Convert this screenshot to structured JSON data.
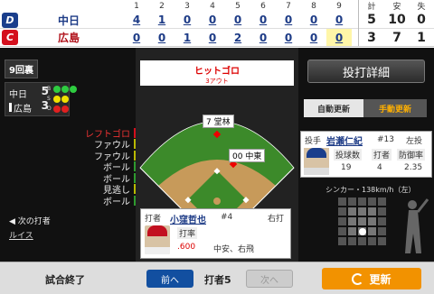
{
  "scoreboard": {
    "innings": [
      "1",
      "2",
      "3",
      "4",
      "5",
      "6",
      "7",
      "8",
      "9"
    ],
    "total_headers": [
      "計",
      "安",
      "失"
    ],
    "teams": [
      {
        "name": "中日",
        "logo": "D",
        "logo_icon": "dragons-logo-icon",
        "runs": [
          "4",
          "1",
          "0",
          "0",
          "0",
          "0",
          "0",
          "0",
          "0"
        ],
        "total": "5",
        "hits": "10",
        "errors": "0"
      },
      {
        "name": "広島",
        "logo": "C",
        "logo_icon": "carp-logo-icon",
        "runs": [
          "0",
          "0",
          "1",
          "0",
          "2",
          "0",
          "0",
          "0",
          "0"
        ],
        "total": "3",
        "hits": "7",
        "errors": "1"
      }
    ],
    "highlight_color": "#fff6a8"
  },
  "left_panel": {
    "inning": "9回裏",
    "mini_score": [
      {
        "team": "中日",
        "score": "5"
      },
      {
        "team": "広島",
        "score": "3"
      }
    ],
    "bso_labels": [
      "B",
      "S",
      "O"
    ],
    "pitch_log": [
      {
        "label": "レフトゴロ",
        "num": "7",
        "color": "#d40f1d"
      },
      {
        "label": "ファウル",
        "num": "6",
        "color": "#b8b800"
      },
      {
        "label": "ファウル",
        "num": "5",
        "color": "#b8b800"
      },
      {
        "label": "ボール",
        "num": "4",
        "color": "#2e9a2e"
      },
      {
        "label": "ボール",
        "num": "3",
        "color": "#2e9a2e"
      },
      {
        "label": "見逃し",
        "num": "2",
        "color": "#b8b800"
      },
      {
        "label": "ボール",
        "num": "1",
        "color": "#2e9a2e"
      }
    ],
    "next_batter_label": "◀ 次の打者",
    "next_batter_name": "ルイス"
  },
  "field": {
    "play_main": "ヒットゴロ",
    "play_sub": "3アウト",
    "fielders": [
      {
        "text": "7 堂林"
      },
      {
        "text": "00 中東"
      }
    ]
  },
  "batter": {
    "role": "打者",
    "name": "小窪哲也",
    "number": "#4",
    "hand": "右打",
    "avg_label": "打率",
    "avg": ".600",
    "result": "中安、右飛"
  },
  "right_panel": {
    "detail_button": "投打詳細",
    "auto_update": "自動更新",
    "manual_update": "手動更新",
    "pitcher": {
      "role": "投手",
      "name": "岩瀬仁紀",
      "number": "#13",
      "hand": "左投",
      "headers": [
        "投球数",
        "打者",
        "防御率"
      ],
      "values": [
        "19",
        "4",
        "2.35"
      ]
    },
    "pitch_info": "シンカー・138km/h（左）"
  },
  "bottom": {
    "game_status": "試合終了",
    "prev_button": "前へ",
    "batter_no": "打者5",
    "next_button": "次へ",
    "refresh_button": "更新"
  }
}
